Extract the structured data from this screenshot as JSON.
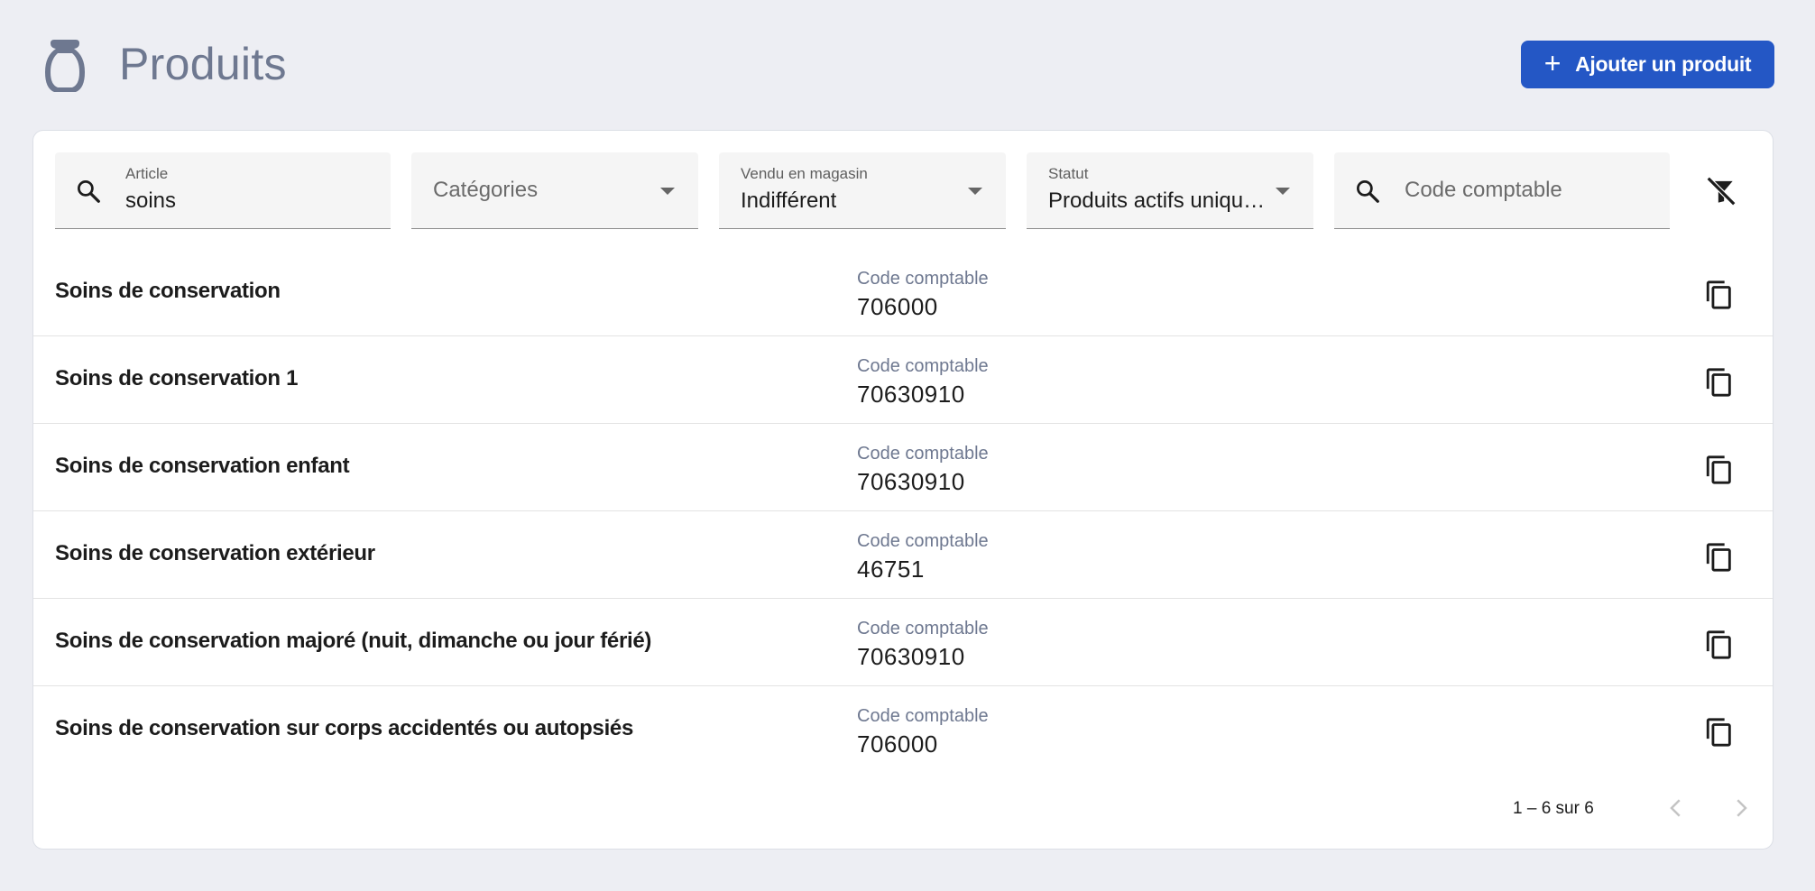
{
  "header": {
    "title": "Produits",
    "logo_icon": "urn-icon",
    "add_button": {
      "icon": "plus-icon",
      "label": "Ajouter un produit"
    }
  },
  "filters": {
    "article": {
      "label": "Article",
      "value": "soins",
      "icon": "search-icon"
    },
    "categories": {
      "placeholder": "Catégories"
    },
    "vendu": {
      "label": "Vendu en magasin",
      "value": "Indifférent"
    },
    "statut": {
      "label": "Statut",
      "value": "Produits actifs uniquement"
    },
    "code": {
      "placeholder": "Code comptable",
      "icon": "search-icon"
    },
    "clear_icon": "filter-off-icon"
  },
  "rows": [
    {
      "name": "Soins de conservation",
      "code_label": "Code comptable",
      "code": "706000"
    },
    {
      "name": "Soins de conservation 1",
      "code_label": "Code comptable",
      "code": "70630910"
    },
    {
      "name": "Soins de conservation enfant",
      "code_label": "Code comptable",
      "code": "70630910"
    },
    {
      "name": "Soins de conservation extérieur",
      "code_label": "Code comptable",
      "code": "46751"
    },
    {
      "name": "Soins de conservation majoré (nuit, dimanche ou jour férié)",
      "code_label": "Code comptable",
      "code": "70630910"
    },
    {
      "name": "Soins de conservation sur corps accidentés ou autopsiés",
      "code_label": "Code comptable",
      "code": "706000"
    }
  ],
  "pagination": {
    "range": "1 – 6 sur 6"
  },
  "colors": {
    "primary": "#2457c5",
    "title": "#6e7890",
    "background": "#edeef3"
  }
}
